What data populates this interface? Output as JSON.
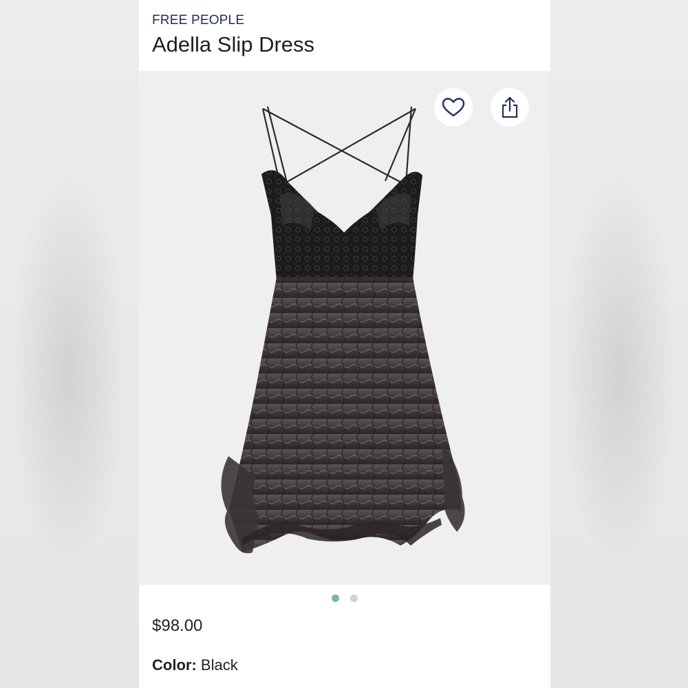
{
  "product": {
    "brand": "FREE PEOPLE",
    "name": "Adella Slip Dress",
    "price": "$98.00",
    "color_label": "Color:",
    "color_value": "Black"
  },
  "actions": {
    "favorite_icon": "heart-icon",
    "share_icon": "share-icon"
  },
  "carousel": {
    "total_images": 2,
    "active_index": 0
  },
  "colors": {
    "brand_text": "#1f2d5c",
    "active_dot": "#7fb4a6",
    "inactive_dot": "#cfd0d2",
    "image_bg": "#efeff0"
  }
}
